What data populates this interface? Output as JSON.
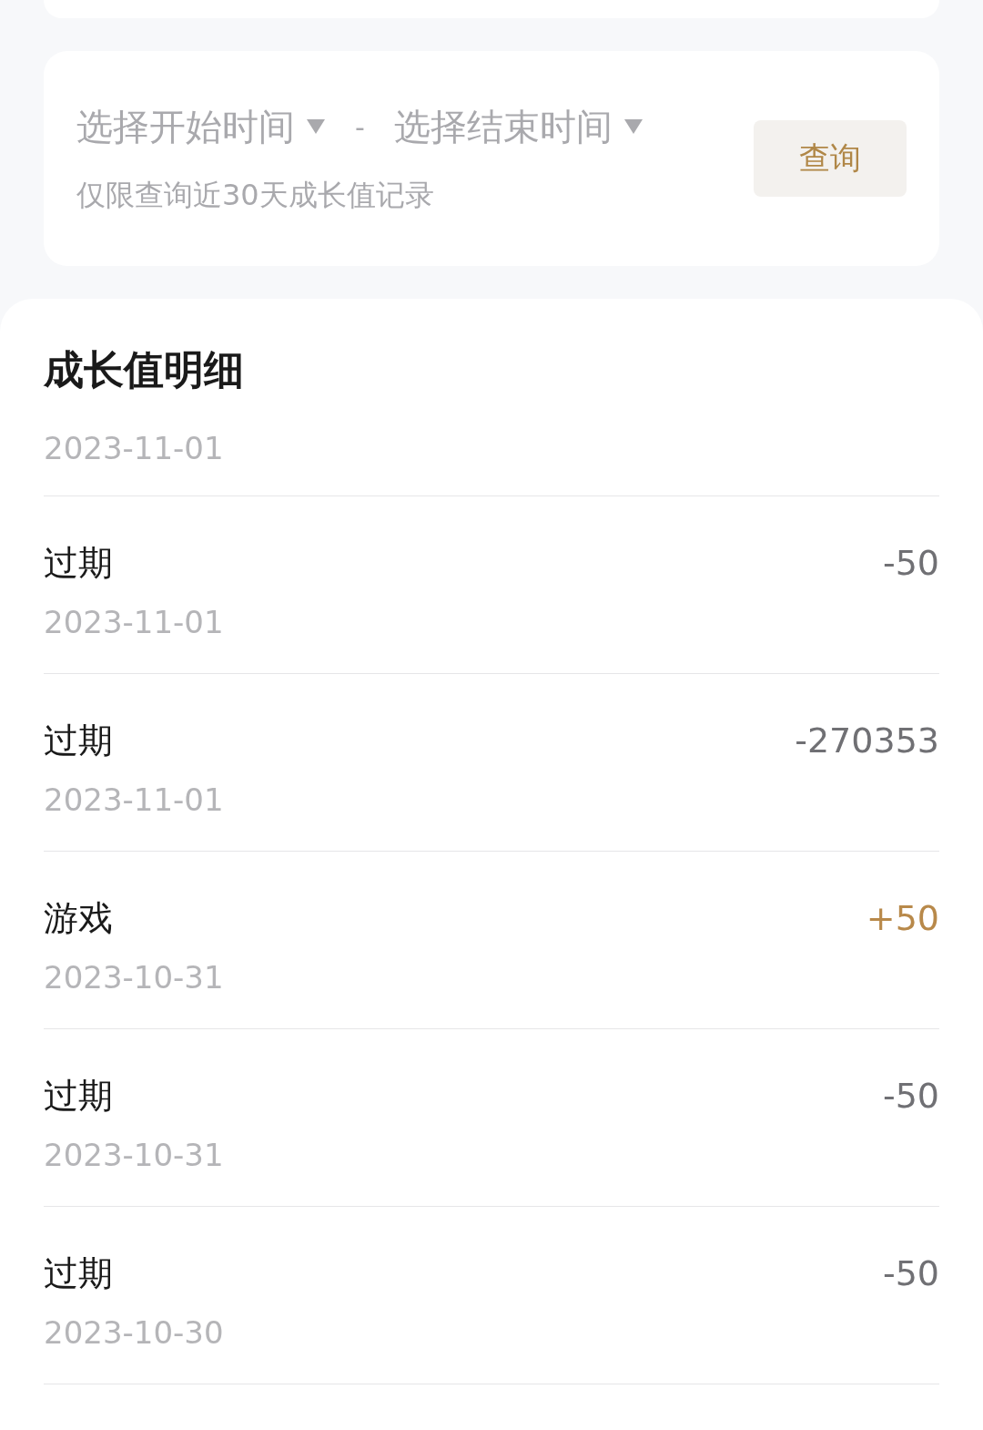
{
  "filter": {
    "start_placeholder": "选择开始时间",
    "separator": "-",
    "end_placeholder": "选择结束时间",
    "note": "仅限查询近30天成长值记录",
    "query_button": "查询"
  },
  "details": {
    "title": "成长值明细",
    "group_date": "2023-11-01",
    "records": [
      {
        "name": "过期",
        "date": "2023-11-01",
        "amount": "-50",
        "kind": "expense"
      },
      {
        "name": "过期",
        "date": "2023-11-01",
        "amount": "-270353",
        "kind": "expense"
      },
      {
        "name": "游戏",
        "date": "2023-10-31",
        "amount": "+50",
        "kind": "income"
      },
      {
        "name": "过期",
        "date": "2023-10-31",
        "amount": "-50",
        "kind": "expense"
      },
      {
        "name": "过期",
        "date": "2023-10-30",
        "amount": "-50",
        "kind": "expense"
      }
    ]
  }
}
